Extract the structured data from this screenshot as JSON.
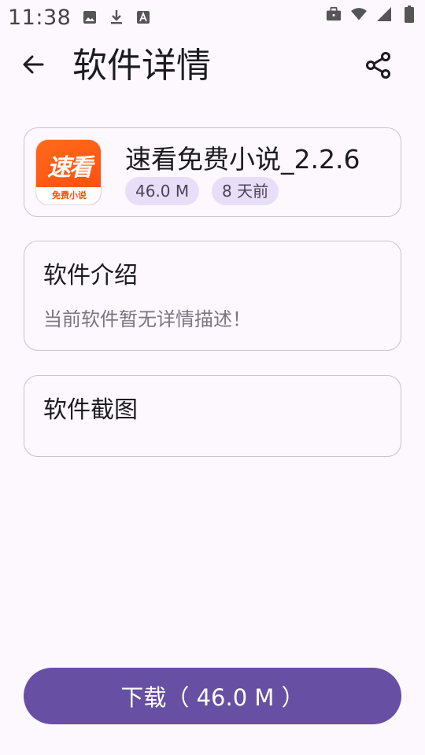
{
  "status_bar": {
    "time": "11:38",
    "left_icons": [
      "image-icon",
      "download-icon",
      "font-icon"
    ],
    "right_icons": [
      "work-icon",
      "wifi-icon",
      "signal-icon",
      "battery-icon"
    ]
  },
  "app_bar": {
    "title": "软件详情",
    "back_icon": "arrow-back-icon",
    "share_icon": "share-icon"
  },
  "app": {
    "name": "速看免费小说_2.2.6",
    "icon_main_text": "速看",
    "icon_sub_text": "免费小说",
    "size": "46.0 M",
    "updated": "8 天前",
    "icon_color": "#ff4a0c"
  },
  "intro": {
    "title": "软件介绍",
    "description": "当前软件暂无详情描述！"
  },
  "screenshots": {
    "title": "软件截图"
  },
  "download": {
    "label": "下载（ 46.0 M ）",
    "color": "#6750a4"
  }
}
